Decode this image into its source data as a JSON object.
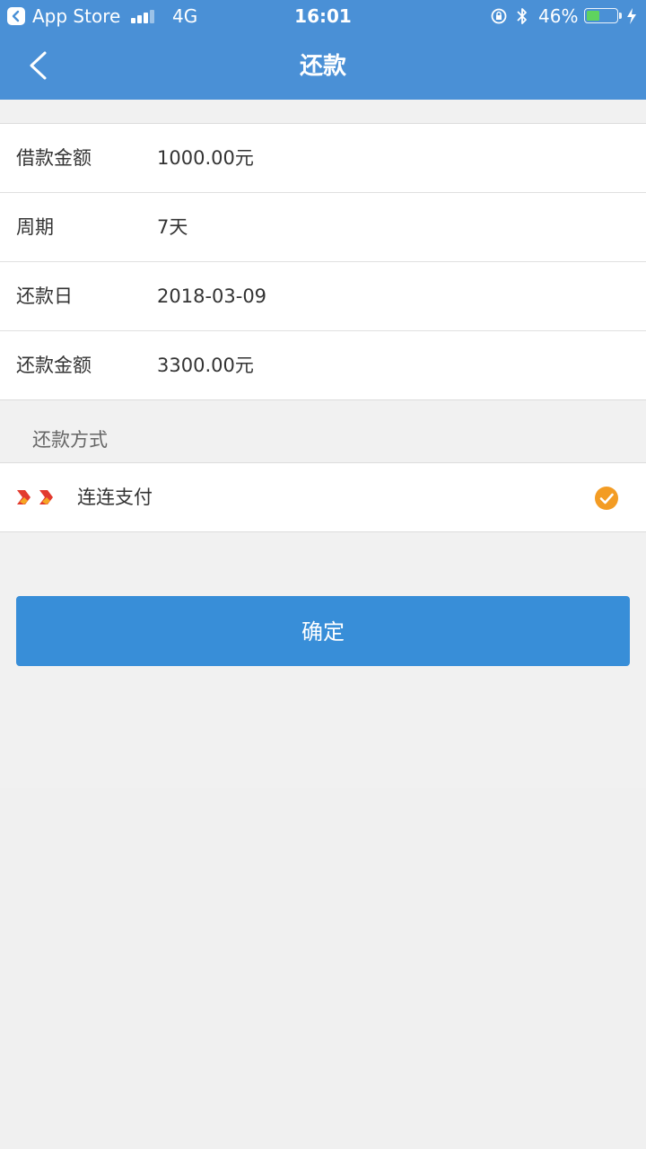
{
  "status_bar": {
    "back_app": "App Store",
    "network": "4G",
    "time": "16:01",
    "battery_percent": "46%",
    "battery_level": 0.46,
    "icons": [
      "app-store-back-icon",
      "signal-icon",
      "rotation-lock-icon",
      "bluetooth-icon",
      "battery-icon",
      "charging-icon"
    ]
  },
  "nav": {
    "title": "还款",
    "back_icon": "chevron-left-icon"
  },
  "info": {
    "rows": [
      {
        "label": "借款金额",
        "value": "1000.00元"
      },
      {
        "label": "周期",
        "value": "7天"
      },
      {
        "label": "还款日",
        "value": "2018-03-09"
      },
      {
        "label": "还款金额",
        "value": "3300.00元"
      }
    ]
  },
  "payment": {
    "section_title": "还款方式",
    "method_label": "连连支付",
    "selected": true,
    "logo_icon": "lianlian-pay-logo",
    "check_icon": "check-circle-icon",
    "check_color": "#f39c24"
  },
  "confirm": {
    "label": "确定"
  },
  "colors": {
    "accent": "#4a90d6",
    "button": "#388ed8",
    "background": "#f1f1f1"
  }
}
